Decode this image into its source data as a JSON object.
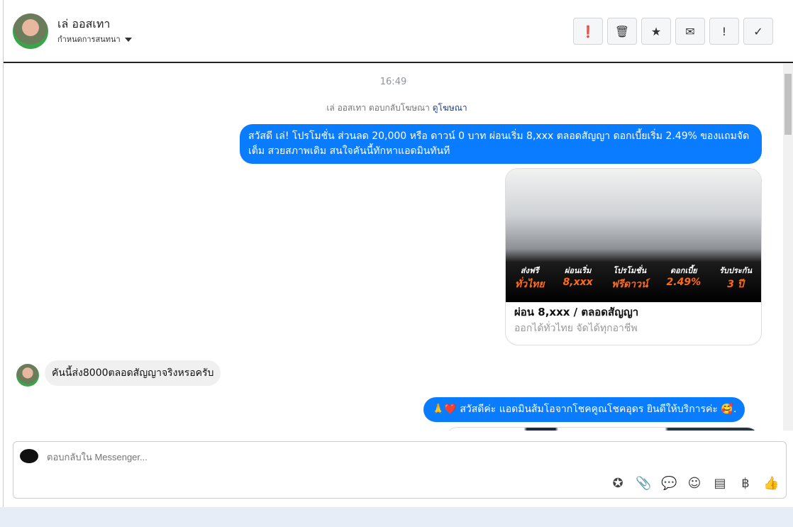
{
  "header": {
    "name": "เล่ ออสเทา",
    "subtitle": "กำหนดการสนทนา",
    "buttons": [
      {
        "icon": "spam-icon",
        "glyph": "❗"
      },
      {
        "icon": "trash-icon",
        "glyph": "🗑"
      },
      {
        "icon": "star-icon",
        "glyph": "★"
      },
      {
        "icon": "envelope-icon",
        "glyph": "✉"
      },
      {
        "icon": "exclamation-icon",
        "glyph": "!"
      },
      {
        "icon": "check-icon",
        "glyph": "✓"
      }
    ]
  },
  "chat": {
    "time": "16:49",
    "ref_text": "เล่ ออสเทา ตอบกลับโฆษณา",
    "ref_link": "ดูโฆษณา",
    "msg1": "สวัสดี เล่! โปรโมชั่น ส่วนลด 20,000 หรือ ดาวน์ 0 บาท ผ่อนเริ่ม 8,xxx ตลอดสัญญา ดอกเบี้ยเริ่ม 2.49% ของแถมจัดเต็ม สวยสภาพเดิม สนใจคันนี้ทักหาแอดมินทันที",
    "card": {
      "title": "ผ่อน 8,xxx / ตลอดสัญญา",
      "subtitle": "ออกได้ทั่วไทย จัดได้ทุกอาชีพ",
      "promo": [
        {
          "top": "ส่งฟรี",
          "main": "ทั่วไทย"
        },
        {
          "top": "ผ่อนเริ่ม",
          "main": "8,xxx"
        },
        {
          "top": "โปรโมชั่น",
          "main": "ฟรีดาวน์"
        },
        {
          "top": "ดอกเบี้ย",
          "main": "2.49%"
        },
        {
          "top": "รับประกัน",
          "main": "3 ปี"
        }
      ]
    },
    "msg_in": "คันนี้ส่ง8000ตลอดสัญญาจริงหรอครับ",
    "msg2": "🙏❤️ สวัสดีค่ะ แอดมินส้มโอจากโชคคูณโชคอุดร ยินดีให้บริการค่ะ 🥰."
  },
  "composer": {
    "placeholder": "ตอบกลับใน Messenger...",
    "tools": [
      {
        "icon": "saved-reply-icon",
        "glyph": "✪"
      },
      {
        "icon": "attach-icon",
        "glyph": "📎"
      },
      {
        "icon": "chat-bubble-icon",
        "glyph": "💬"
      },
      {
        "icon": "emoji-icon",
        "glyph": "☺"
      },
      {
        "icon": "notes-icon",
        "glyph": "▤"
      },
      {
        "icon": "baht-icon",
        "glyph": "฿"
      },
      {
        "icon": "like-icon",
        "glyph": "👍"
      }
    ]
  }
}
